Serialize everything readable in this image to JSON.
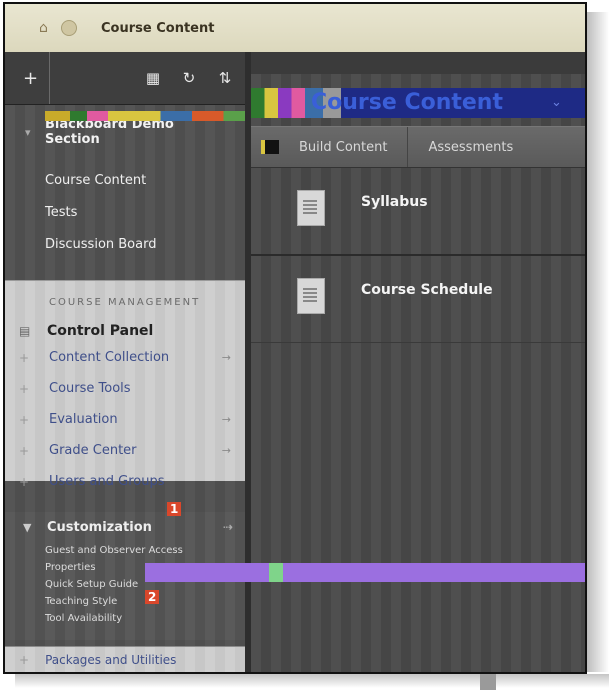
{
  "breadcrumb": {
    "label": "Course Content"
  },
  "sidebar": {
    "course_name_line1": "Blackboard Demo",
    "course_name_line2": "Section",
    "course_links": [
      "Course Content",
      "Tests",
      "Discussion Board"
    ],
    "management": {
      "heading": "COURSE MANAGEMENT",
      "control_panel": "Control Panel",
      "tools": [
        "Content Collection",
        "Course Tools",
        "Evaluation",
        "Grade Center",
        "Users and Groups"
      ],
      "customization": {
        "label": "Customization",
        "items": [
          "Guest and Observer Access",
          "Properties",
          "Quick Setup Guide",
          "Teaching Style",
          "Tool Availability"
        ]
      },
      "packages": "Packages and Utilities"
    }
  },
  "callouts": {
    "one": "1",
    "two": "2"
  },
  "main": {
    "title": "Course Content",
    "actions": {
      "build": "Build Content",
      "assessments": "Assessments"
    },
    "items": [
      {
        "title": "Syllabus"
      },
      {
        "title": "Course Schedule"
      }
    ]
  }
}
